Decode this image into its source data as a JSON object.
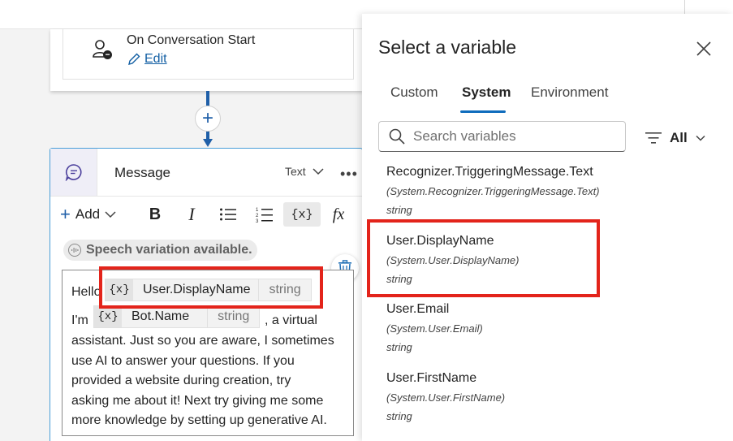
{
  "trigger": {
    "title": "On Conversation Start",
    "edit_label": "Edit"
  },
  "message_node": {
    "title": "Message",
    "type_label": "Text",
    "toolbar": {
      "add_label": "Add",
      "variable_label": "{x}"
    },
    "speech_notice": "Speech variation available.",
    "text": {
      "line1_prefix": "Hello",
      "line1_suffix": ",",
      "line2_prefix": "I'm",
      "line2_suffix": ", a virtual",
      "lines": [
        "assistant. Just so you are aware, I sometimes",
        "use AI to answer your questions. If you",
        "provided a website during creation, try",
        "asking me about it! Next try giving me some",
        "more knowledge by setting up generative AI."
      ]
    },
    "chips": [
      {
        "icon": "{x}",
        "name": "User.DisplayName",
        "type": "string"
      },
      {
        "icon": "{x}",
        "name": "Bot.Name",
        "type": "string"
      }
    ]
  },
  "panel": {
    "title": "Select a variable",
    "tabs": [
      "Custom",
      "System",
      "Environment"
    ],
    "active_tab": "System",
    "search_placeholder": "Search variables",
    "filter_label": "All",
    "variables": [
      {
        "name": "Recognizer.TriggeringMessage.Text",
        "path": "(System.Recognizer.TriggeringMessage.Text)",
        "type": "string"
      },
      {
        "name": "User.DisplayName",
        "path": "(System.User.DisplayName)",
        "type": "string"
      },
      {
        "name": "User.Email",
        "path": "(System.User.Email)",
        "type": "string"
      },
      {
        "name": "User.FirstName",
        "path": "(System.User.FirstName)",
        "type": "string"
      }
    ]
  },
  "colors": {
    "accent": "#0f6cbd",
    "connector": "#1f5fa8",
    "highlight": "#e3241b"
  }
}
